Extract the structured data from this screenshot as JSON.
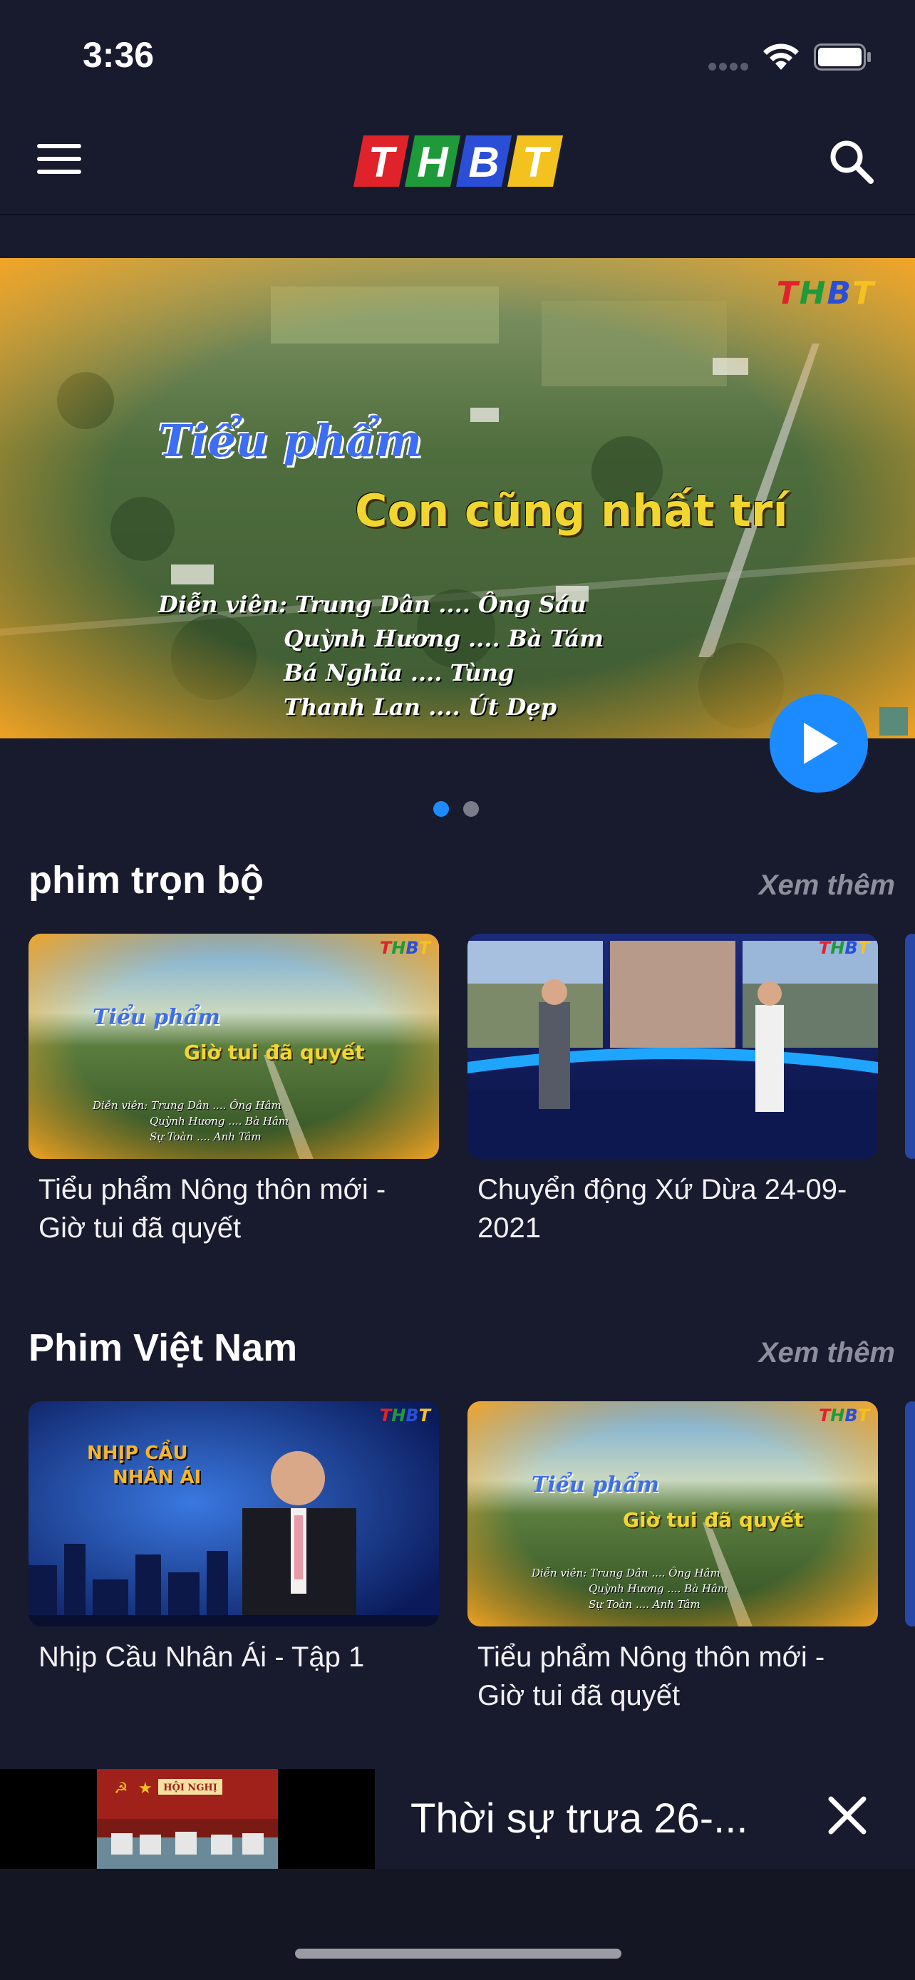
{
  "status_bar": {
    "time": "3:36"
  },
  "header": {
    "logo": "THBT",
    "logo_letters": [
      "T",
      "H",
      "B",
      "T"
    ]
  },
  "hero": {
    "title_line1": "Tiểu phẩm",
    "title_line2": "Con cũng nhất trí",
    "credits": [
      "Diễn viên: Trung Dân .... Ông Sáu",
      "Quỳnh Hương .... Bà Tám",
      "Bá Nghĩa .... Tùng",
      "Thanh Lan .... Út Dẹp"
    ],
    "watermark": "THBT",
    "slide_count": 2,
    "active_slide": 1
  },
  "sections": [
    {
      "title": "phim trọn bộ",
      "see_more": "Xem thêm",
      "items": [
        {
          "title": "Tiểu phẩm Nông thôn mới - Giờ tui đã quyết"
        },
        {
          "title": "Chuyển động Xứ Dừa 24-09-2021"
        }
      ]
    },
    {
      "title": "Phim Việt Nam",
      "see_more": "Xem thêm",
      "items": [
        {
          "title": "Nhịp Cầu Nhân Ái - Tập 1"
        },
        {
          "title": "Tiểu phẩm Nông thôn mới - Giờ tui đã quyết"
        }
      ]
    }
  ],
  "thumb_text": {
    "mark": "THBT",
    "tp_line1": "Tiểu phẩm",
    "tp_line2": "Giờ tui đã quyết",
    "tp_credits": [
      "Diễn viên: Trung Dân .... Ông Hâm",
      "Quỳnh Hương .... Bà Hâm",
      "Sự Toàn .... Anh Tâm"
    ],
    "show_line1": "NHỊP CẦU",
    "show_line2": "NHÂN ÁI"
  },
  "mini_player": {
    "title": "Thời sự trưa 26-...",
    "thumb_banner": "HỘI NGHỊ"
  },
  "colors": {
    "background": "#181a2e",
    "accent": "#1c8bff",
    "muted": "#8d8f9c",
    "logo_red": "#e0232a",
    "logo_green": "#1f9a3a",
    "logo_blue": "#2a4fd6",
    "logo_yellow": "#f4c21f"
  }
}
